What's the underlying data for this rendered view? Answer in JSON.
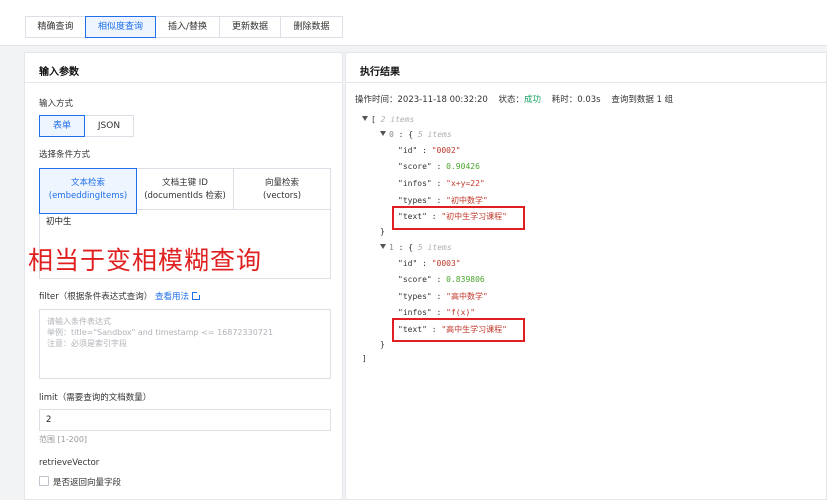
{
  "tabs": [
    "精确查询",
    "相似度查询",
    "插入/替换",
    "更新数据",
    "删除数据"
  ],
  "left": {
    "title": "输入参数",
    "input_mode_label": "输入方式",
    "input_modes": [
      "表单",
      "JSON"
    ],
    "condition_label": "选择条件方式",
    "methods": [
      {
        "name": "文本检索",
        "sub": "(embeddingItems)"
      },
      {
        "name": "文档主键 ID",
        "sub": "(documentIds 检索)"
      },
      {
        "name": "向量检索",
        "sub": "(vectors)"
      }
    ],
    "text_value": "初中生",
    "overlay": "相当于变相模糊查询",
    "filter_label": "filter（根据条件表达式查询）",
    "filter_link": "查看用法",
    "filter_placeholder_1": "请输入条件表达式",
    "filter_placeholder_2": "举例：title=\"Sandbox\" and timestamp <= 16872330721",
    "filter_placeholder_3": "注意：必须是索引字段",
    "limit_label": "limit（需要查询的文档数量）",
    "limit_value": "2",
    "limit_hint": "范围 [1-200]",
    "retrieve_label": "retrieveVector",
    "retrieve_checkbox": "是否返回向量字段"
  },
  "right": {
    "title": "执行结果",
    "op_time_label": "操作时间：",
    "op_time": "2023-11-18 00:32:20",
    "status_label": "状态：",
    "status": "成功",
    "elapsed_label": "耗时：",
    "elapsed": "0.03s",
    "found": "查询到数据 1 组"
  },
  "result": {
    "root_count": "2 items",
    "items": [
      {
        "index": "0",
        "count": "5 items",
        "fields": [
          {
            "k": "\"id\"",
            "v": "\"0002\"",
            "t": "str"
          },
          {
            "k": "\"score\"",
            "v": "0.90426",
            "t": "num"
          },
          {
            "k": "\"infos\"",
            "v": "\"x+y=22\"",
            "t": "str"
          },
          {
            "k": "\"types\"",
            "v": "\"初中数学\"",
            "t": "str"
          },
          {
            "k": "\"text\"",
            "v": "\"初中生学习课程\"",
            "t": "str"
          }
        ]
      },
      {
        "index": "1",
        "count": "5 items",
        "fields": [
          {
            "k": "\"id\"",
            "v": "\"0003\"",
            "t": "str"
          },
          {
            "k": "\"score\"",
            "v": "0.839806",
            "t": "num"
          },
          {
            "k": "\"types\"",
            "v": "\"高中数学\"",
            "t": "str"
          },
          {
            "k": "\"infos\"",
            "v": "\"f(x)\"",
            "t": "str"
          },
          {
            "k": "\"text\"",
            "v": "\"高中生学习课程\"",
            "t": "str"
          }
        ]
      }
    ]
  }
}
